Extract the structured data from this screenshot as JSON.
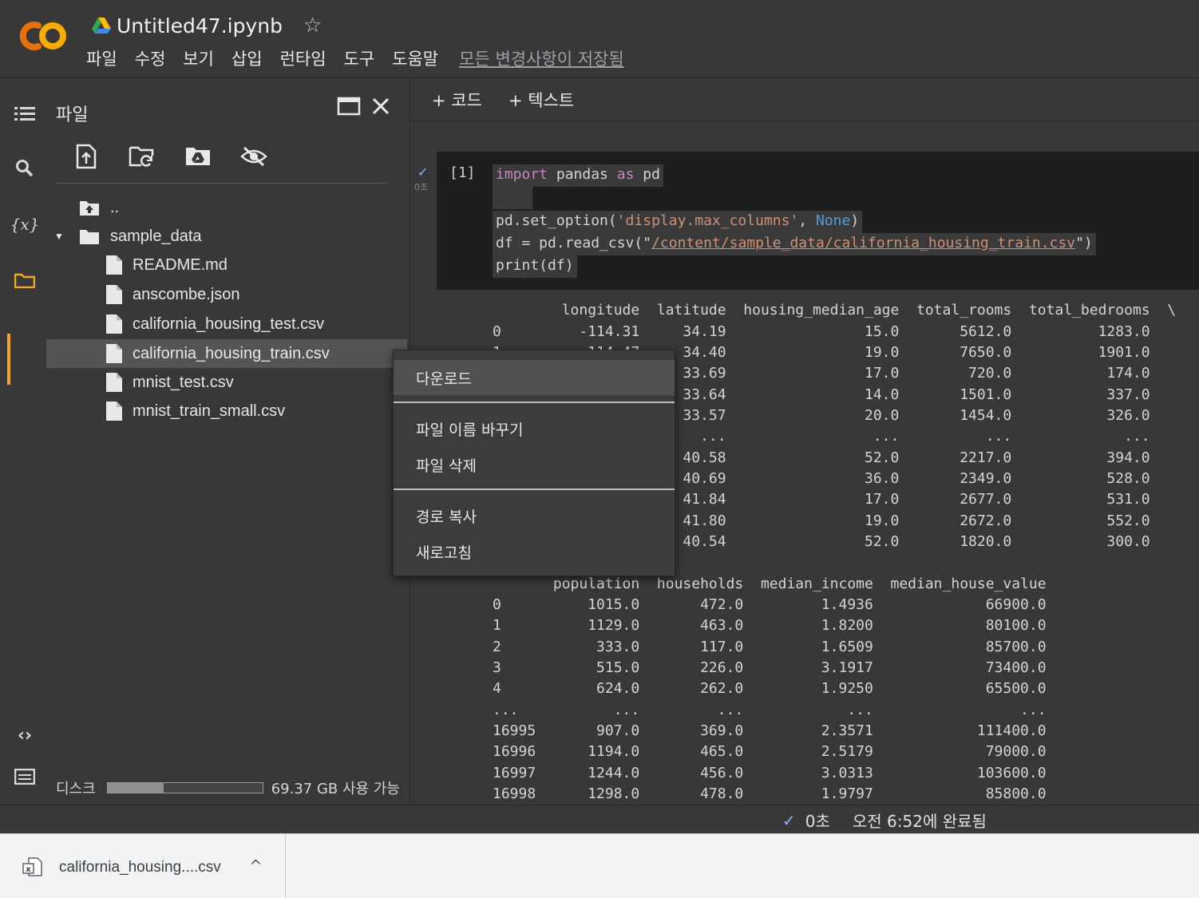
{
  "header": {
    "notebook_title": "Untitled47.ipynb",
    "menu": [
      "파일",
      "수정",
      "보기",
      "삽입",
      "런타임",
      "도구",
      "도움말"
    ],
    "save_status": "모든 변경사항이 저장됨",
    "logo_colors": {
      "primary": "#f9ab00",
      "secondary": "#e8710a"
    }
  },
  "rail": {
    "icons": [
      "toc-icon",
      "search-icon",
      "variables-icon",
      "folder-icon",
      "code-snippets-icon",
      "terminal-icon"
    ],
    "variables_label": "{x}",
    "accent": "#f5a623"
  },
  "files_panel": {
    "title": "파일",
    "parent_dir": "..",
    "folder": "sample_data",
    "files": [
      "README.md",
      "anscombe.json",
      "california_housing_test.csv",
      "california_housing_train.csv",
      "mnist_test.csv",
      "mnist_train_small.csv"
    ],
    "selected_file": "california_housing_train.csv",
    "disk_label": "디스크",
    "disk_available": "69.37 GB 사용 가능",
    "disk_used_fraction": 0.36
  },
  "toolbar": {
    "add_code": "+ 코드",
    "add_text": "+ 텍스트"
  },
  "cell": {
    "exec_count": "[1]",
    "exec_time": "0초",
    "code": {
      "line1_kw1": "import",
      "line1_mid": " pandas ",
      "line1_kw2": "as",
      "line1_end": " pd",
      "line3_a": "pd.set_option(",
      "line3_str": "'display.max_columns'",
      "line3_b": ", ",
      "line3_none": "None",
      "line3_c": ")",
      "line4_a": "df = pd.read_csv(\"",
      "line4_path": "/content/sample_data/california_housing_train.csv",
      "line4_b": "\")",
      "line5": "print(df)"
    }
  },
  "output": {
    "header1": "        longitude  latitude  housing_median_age  total_rooms  total_bedrooms  \\",
    "rows1": [
      "0         -114.31     34.19                15.0       5612.0          1283.0",
      "1         -114.47     34.40                19.0       7650.0          1901.0",
      "2         -114.56     33.69                17.0        720.0           174.0",
      "3         -114.57     33.64                14.0       1501.0           337.0",
      "4         -114.57     33.57                20.0       1454.0           326.0",
      "...           ...       ...                 ...          ...             ...",
      "16995     -124.26     40.58                52.0       2217.0           394.0",
      "16996     -124.27     40.69                36.0       2349.0           528.0",
      "16997     -124.30     41.84                17.0       2677.0           531.0",
      "16998     -124.30     41.80                19.0       2672.0           552.0",
      "16999     -124.35     40.54                52.0       1820.0           300.0"
    ],
    "header2": "       population  households  median_income  median_house_value",
    "rows2": [
      "0          1015.0       472.0         1.4936             66900.0",
      "1          1129.0       463.0         1.8200             80100.0",
      "2           333.0       117.0         1.6509             85700.0",
      "3           515.0       226.0         3.1917             73400.0",
      "4           624.0       262.0         1.9250             65500.0",
      "...           ...         ...            ...                 ...",
      "16995       907.0       369.0         2.3571            111400.0",
      "16996      1194.0       465.0         2.5179             79000.0",
      "16997      1244.0       456.0         3.0313            103600.0",
      "16998      1298.0       478.0         1.9797             85800.0"
    ]
  },
  "context_menu": {
    "download": "다운로드",
    "rename": "파일 이름 바꾸기",
    "delete": "파일 삭제",
    "copy_path": "경로 복사",
    "refresh": "새로고침"
  },
  "status_bar": {
    "duration": "0초",
    "completed": "오전 6:52에 완료됨"
  },
  "download_shelf": {
    "filename": "california_housing....csv"
  }
}
